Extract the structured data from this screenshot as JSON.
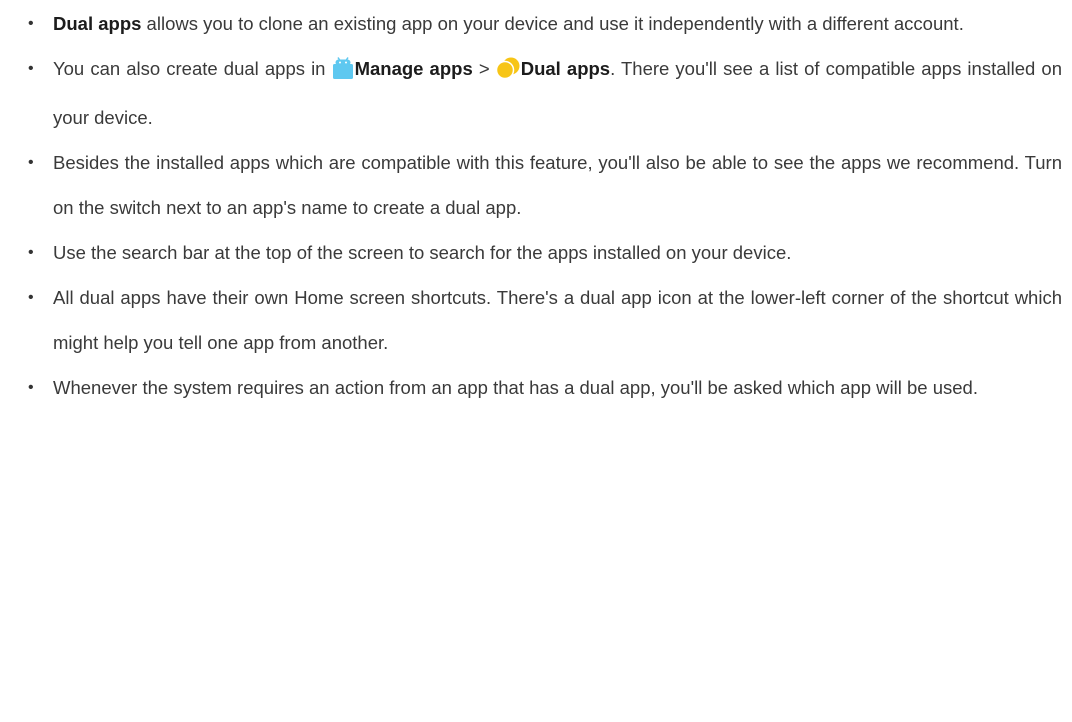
{
  "items": [
    {
      "bold": "Dual apps",
      "text": " allows you to clone an existing app on your device and use it independently with a different account."
    },
    {
      "pre": "You can also create dual apps in ",
      "link1": "Manage apps",
      "sep": " > ",
      "link2": "Dual apps",
      "post": ". There you'll see a list of compatible apps installed on your device."
    },
    {
      "text": "Besides the installed apps which are compatible with this feature, you'll also be able to see the apps we recommend. Turn on the switch next to an app's name to create a dual app."
    },
    {
      "text": "Use the search bar at the top of the screen to search for the apps installed on your device."
    },
    {
      "text": "All dual apps have their own Home screen shortcuts. There's a dual app icon at the lower-left corner of the shortcut which might help you tell one app from another."
    },
    {
      "text": "Whenever the system requires an action from an app that has a dual app, you'll be asked which app will be used."
    }
  ],
  "bullet": "•",
  "icons": {
    "manage_apps": {
      "name": "manage-apps-icon",
      "color": "#5ec8f0"
    },
    "dual_apps": {
      "name": "dual-apps-icon",
      "color": "#f7c516"
    }
  }
}
